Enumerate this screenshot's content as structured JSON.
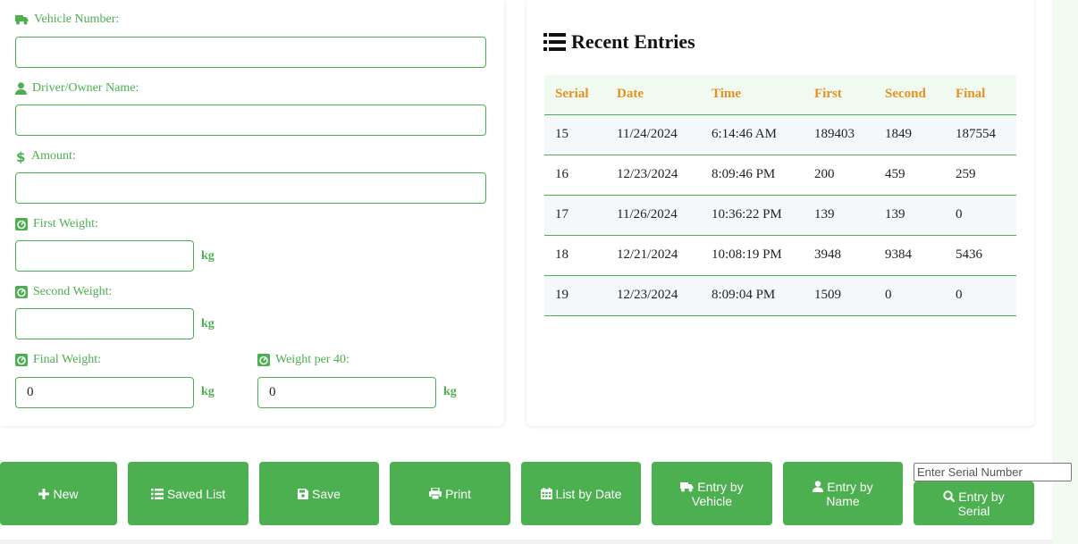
{
  "form": {
    "vehicle_label": "Vehicle Number:",
    "vehicle_value": "",
    "driver_label": "Driver/Owner Name:",
    "driver_value": "",
    "amount_label": "Amount:",
    "amount_value": "",
    "first_weight_label": "First Weight:",
    "first_weight_value": "",
    "second_weight_label": "Second Weight:",
    "second_weight_value": "",
    "final_weight_label": "Final Weight:",
    "final_weight_value": "0",
    "weight40_label": "Weight per 40:",
    "weight40_value": "0",
    "unit": "kg"
  },
  "recent": {
    "title": "Recent Entries",
    "columns": [
      "Serial",
      "Date",
      "Time",
      "First",
      "Second",
      "Final"
    ],
    "rows": [
      [
        "15",
        "11/24/2024",
        "6:14:46 AM",
        "189403",
        "1849",
        "187554"
      ],
      [
        "16",
        "12/23/2024",
        "8:09:46 PM",
        "200",
        "459",
        "259"
      ],
      [
        "17",
        "11/26/2024",
        "10:36:22 PM",
        "139",
        "139",
        "0"
      ],
      [
        "18",
        "12/21/2024",
        "10:08:19 PM",
        "3948",
        "9384",
        "5436"
      ],
      [
        "19",
        "12/23/2024",
        "8:09:04 PM",
        "1509",
        "0",
        "0"
      ]
    ]
  },
  "toolbar": {
    "new_label": "New",
    "saved_list_label": "Saved List",
    "save_label": "Save",
    "print_label": "Print",
    "list_by_date_label": "List by Date",
    "entry_by_vehicle_label": "Entry by Vehicle",
    "entry_by_name_label": "Entry by Name",
    "entry_by_serial_label": "Entry by Serial",
    "serial_placeholder": "Enter Serial Number"
  },
  "icons": {
    "vehicle": "truck-icon",
    "driver": "user-icon",
    "amount": "dollar-icon",
    "weight": "weight-icon",
    "title": "list-icon",
    "new": "plus-icon",
    "saved_list": "list-icon",
    "save": "floppy-disk-icon",
    "print": "printer-icon",
    "list_by_date": "calendar-icon",
    "entry_by_vehicle": "truck-icon",
    "entry_by_name": "user-icon",
    "entry_by_serial": "search-icon"
  },
  "colors": {
    "accent": "#4caf50",
    "header_text": "#e69020",
    "button_text": "#ffffff"
  }
}
